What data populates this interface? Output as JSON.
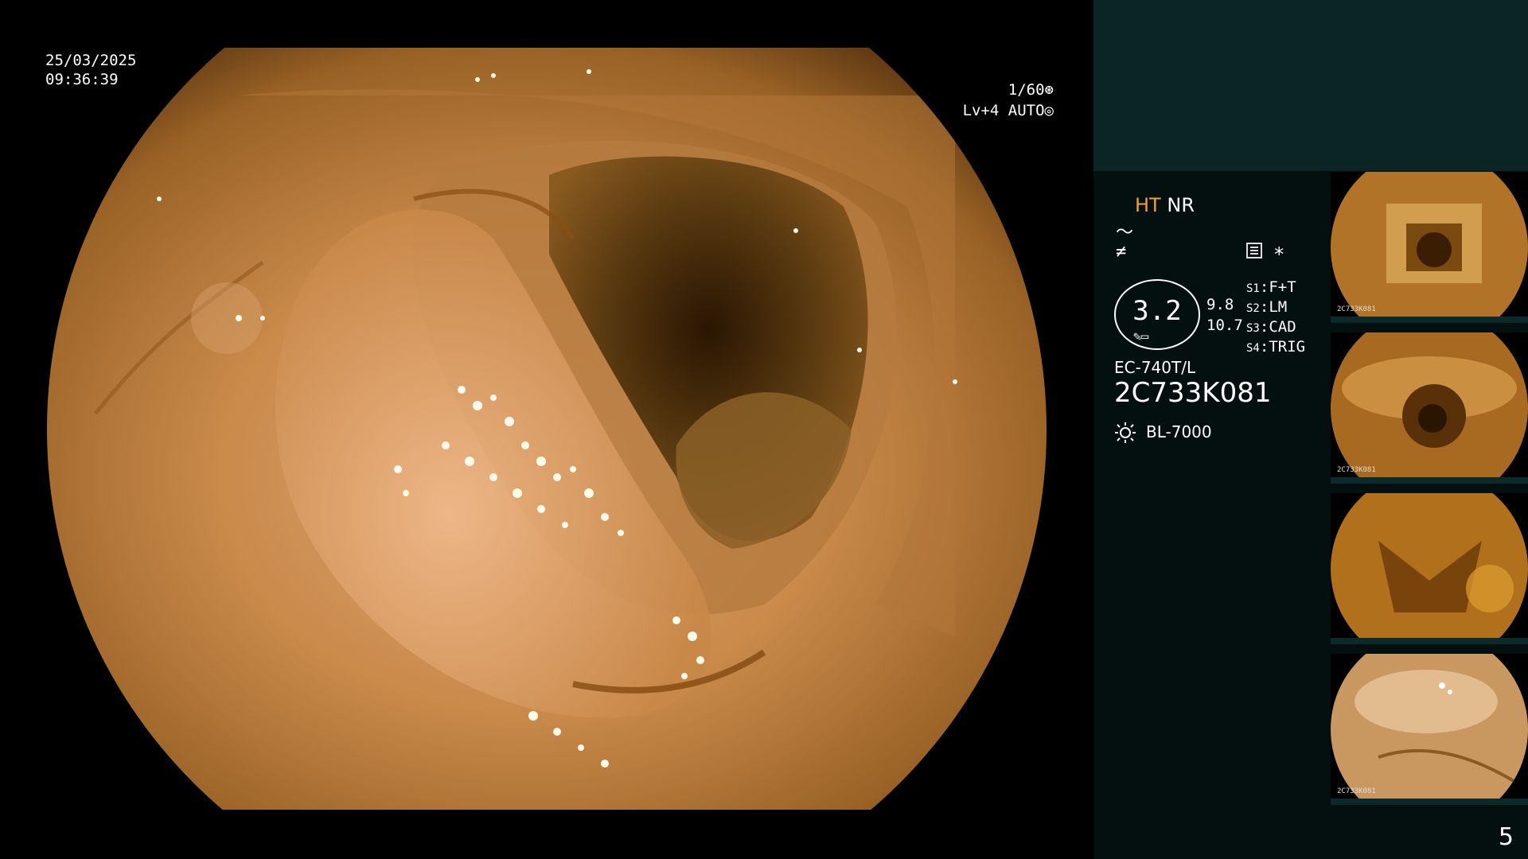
{
  "overlay": {
    "date": "25/03/2025",
    "time": "09:36:39",
    "shutter": "1/60",
    "level": "Lv+4 AUTO"
  },
  "panel": {
    "ht_label": "HT",
    "nr_label": "NR",
    "mode_symbol": "〜",
    "filter_symbol": "≠",
    "star_symbol": "*",
    "gauge_value": "3.2",
    "gauge_readings": [
      "9.8",
      "10.7"
    ],
    "switches": [
      {
        "key": "S1",
        "value": "F+T"
      },
      {
        "key": "S2",
        "value": "LM"
      },
      {
        "key": "S3",
        "value": "CAD"
      },
      {
        "key": "S4",
        "value": "TRIG"
      }
    ],
    "scope_model": "EC-740T/L",
    "serial": "2C733K081",
    "light_source": "BL-7000",
    "thumbnail_captions": [
      "2C733K081",
      "2C733K081",
      "",
      "2C733K081"
    ],
    "page_number": "5"
  },
  "colors": {
    "panel_background": "#03100f",
    "panel_header": "#0a2524",
    "ht_accent": "#f4a12c",
    "mucosa": "#c98a4a"
  },
  "icons": [
    "shutter-icon",
    "iris-icon",
    "menu-icon",
    "star-icon",
    "light-source-icon"
  ]
}
